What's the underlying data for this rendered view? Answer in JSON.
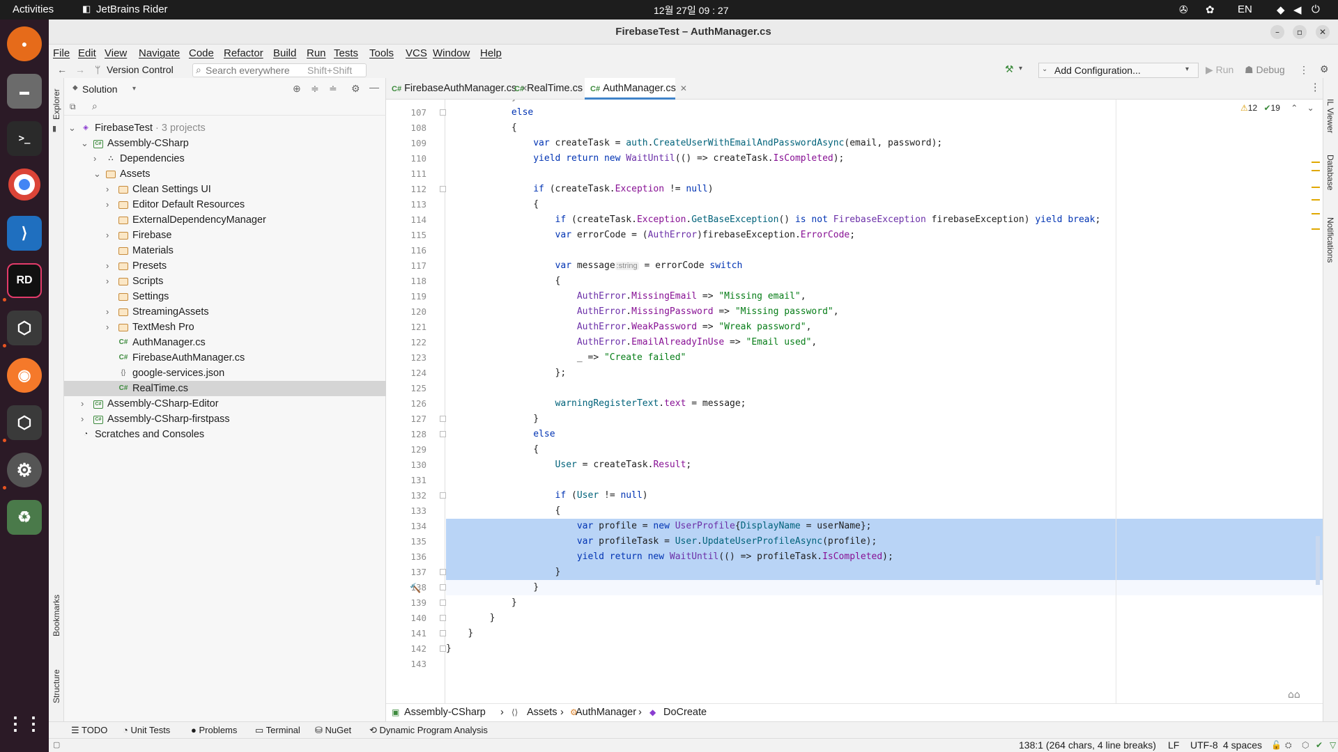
{
  "system": {
    "activities": "Activities",
    "app_name": "JetBrains Rider",
    "clock": "12월 27일  09 : 27",
    "lang": "EN"
  },
  "window": {
    "title": "FirebaseTest – AuthManager.cs"
  },
  "menu": [
    "File",
    "Edit",
    "View",
    "Navigate",
    "Code",
    "Refactor",
    "Build",
    "Run",
    "Tests",
    "Tools",
    "VCS",
    "Window",
    "Help"
  ],
  "toolbar": {
    "version_control": "Version Control",
    "search_label": "Search everywhere",
    "search_shortcut": "Shift+Shift",
    "config": "Add Configuration...",
    "run": "Run",
    "debug": "Debug"
  },
  "side": {
    "explorer": "Explorer",
    "bookmarks": "Bookmarks",
    "structure": "Structure",
    "il_viewer": "IL Viewer",
    "database": "Database",
    "notifications": "Notifications"
  },
  "explorer": {
    "header": "Solution",
    "tree": [
      {
        "label": "FirebaseTest",
        "suffix": " · 3 projects",
        "icon": "sln",
        "depth": 0,
        "arrow": "v"
      },
      {
        "label": "Assembly-CSharp",
        "icon": "proj",
        "depth": 1,
        "arrow": "v"
      },
      {
        "label": "Dependencies",
        "icon": "deps",
        "depth": 2,
        "arrow": ">"
      },
      {
        "label": "Assets",
        "icon": "folder",
        "depth": 2,
        "arrow": "v"
      },
      {
        "label": "Clean Settings UI",
        "icon": "folder",
        "depth": 3,
        "arrow": ">"
      },
      {
        "label": "Editor Default Resources",
        "icon": "folder",
        "depth": 3,
        "arrow": ">"
      },
      {
        "label": "ExternalDependencyManager",
        "icon": "folder",
        "depth": 3,
        "arrow": ""
      },
      {
        "label": "Firebase",
        "icon": "folder",
        "depth": 3,
        "arrow": ">"
      },
      {
        "label": "Materials",
        "icon": "folder",
        "depth": 3,
        "arrow": ""
      },
      {
        "label": "Presets",
        "icon": "folder",
        "depth": 3,
        "arrow": ">"
      },
      {
        "label": "Scripts",
        "icon": "folder",
        "depth": 3,
        "arrow": ">"
      },
      {
        "label": "Settings",
        "icon": "folder",
        "depth": 3,
        "arrow": ""
      },
      {
        "label": "StreamingAssets",
        "icon": "folder",
        "depth": 3,
        "arrow": ">"
      },
      {
        "label": "TextMesh Pro",
        "icon": "folder",
        "depth": 3,
        "arrow": ">"
      },
      {
        "label": "AuthManager.cs",
        "icon": "cs",
        "depth": 3,
        "arrow": ""
      },
      {
        "label": "FirebaseAuthManager.cs",
        "icon": "cs",
        "depth": 3,
        "arrow": ""
      },
      {
        "label": "google-services.json",
        "icon": "json",
        "depth": 3,
        "arrow": ""
      },
      {
        "label": "RealTime.cs",
        "icon": "cs",
        "depth": 3,
        "arrow": "",
        "selected": true
      },
      {
        "label": "Assembly-CSharp-Editor",
        "icon": "proj",
        "depth": 1,
        "arrow": ">"
      },
      {
        "label": "Assembly-CSharp-firstpass",
        "icon": "proj",
        "depth": 1,
        "arrow": ">"
      },
      {
        "label": "Scratches and Consoles",
        "icon": "scratch",
        "depth": 0,
        "arrow": ""
      }
    ]
  },
  "tabs": [
    {
      "label": "FirebaseAuthManager.cs",
      "active": false
    },
    {
      "label": "RealTime.cs",
      "active": false
    },
    {
      "label": "AuthManager.cs",
      "active": true
    }
  ],
  "inspections": {
    "warnings": "12",
    "ok": "19"
  },
  "editor": {
    "first_line": 107,
    "lines": [
      {
        "n": "107",
        "ind": 6,
        "t": [
          [
            "kw",
            "else"
          ]
        ]
      },
      {
        "n": "108",
        "ind": 6,
        "t": [
          [
            "",
            "{"
          ]
        ]
      },
      {
        "n": "109",
        "ind": 8,
        "t": [
          [
            "kw",
            "var"
          ],
          [
            "",
            " createTask = "
          ],
          [
            "me",
            "auth"
          ],
          [
            "",
            "."
          ],
          [
            "me",
            "CreateUserWithEmailAndPasswordAsync"
          ],
          [
            "",
            "(email, password);"
          ]
        ]
      },
      {
        "n": "110",
        "ind": 8,
        "t": [
          [
            "kw",
            "yield return new "
          ],
          [
            "ty",
            "WaitUntil"
          ],
          [
            "",
            "(() => createTask."
          ],
          [
            "pr",
            "IsCompleted"
          ],
          [
            "",
            ");"
          ]
        ]
      },
      {
        "n": "111",
        "ind": 0,
        "t": []
      },
      {
        "n": "112",
        "ind": 8,
        "t": [
          [
            "kw",
            "if"
          ],
          [
            "",
            " (createTask."
          ],
          [
            "pr",
            "Exception"
          ],
          [
            "",
            " != "
          ],
          [
            "kw",
            "null"
          ],
          [
            "",
            ")"
          ]
        ]
      },
      {
        "n": "113",
        "ind": 8,
        "t": [
          [
            "",
            "{"
          ]
        ]
      },
      {
        "n": "114",
        "ind": 10,
        "t": [
          [
            "kw",
            "if"
          ],
          [
            "",
            " (createTask."
          ],
          [
            "pr",
            "Exception"
          ],
          [
            "",
            "."
          ],
          [
            "me",
            "GetBaseException"
          ],
          [
            "",
            "() "
          ],
          [
            "kw",
            "is not "
          ],
          [
            "ty",
            "FirebaseException"
          ],
          [
            "",
            " firebaseException) "
          ],
          [
            "kw",
            "yield break"
          ],
          [
            "",
            ";"
          ]
        ]
      },
      {
        "n": "115",
        "ind": 10,
        "t": [
          [
            "kw",
            "var"
          ],
          [
            "",
            " errorCode = ("
          ],
          [
            "ty",
            "AuthError"
          ],
          [
            "",
            ")firebaseException."
          ],
          [
            "pr",
            "ErrorCode"
          ],
          [
            "",
            ";"
          ]
        ]
      },
      {
        "n": "116",
        "ind": 0,
        "t": []
      },
      {
        "n": "117",
        "ind": 10,
        "t": [
          [
            "kw",
            "var"
          ],
          [
            "",
            " message"
          ],
          [
            "hint",
            ":string"
          ],
          [
            "",
            " = errorCode "
          ],
          [
            "kw",
            "switch"
          ]
        ]
      },
      {
        "n": "118",
        "ind": 10,
        "t": [
          [
            "",
            "{"
          ]
        ]
      },
      {
        "n": "119",
        "ind": 12,
        "t": [
          [
            "ty",
            "AuthError"
          ],
          [
            "",
            "."
          ],
          [
            "pr",
            "MissingEmail"
          ],
          [
            "",
            " => "
          ],
          [
            "st",
            "\"Missing email\""
          ],
          [
            "",
            ","
          ]
        ]
      },
      {
        "n": "120",
        "ind": 12,
        "t": [
          [
            "ty",
            "AuthError"
          ],
          [
            "",
            "."
          ],
          [
            "pr",
            "MissingPassword"
          ],
          [
            "",
            " => "
          ],
          [
            "st",
            "\"Missing password\""
          ],
          [
            "",
            ","
          ]
        ]
      },
      {
        "n": "121",
        "ind": 12,
        "t": [
          [
            "ty",
            "AuthError"
          ],
          [
            "",
            "."
          ],
          [
            "pr",
            "WeakPassword"
          ],
          [
            "",
            " => "
          ],
          [
            "st",
            "\"Wreak password\""
          ],
          [
            "",
            ","
          ]
        ]
      },
      {
        "n": "122",
        "ind": 12,
        "t": [
          [
            "ty",
            "AuthError"
          ],
          [
            "",
            "."
          ],
          [
            "pr",
            "EmailAlreadyInUse"
          ],
          [
            "",
            " => "
          ],
          [
            "st",
            "\"Email used\""
          ],
          [
            "",
            ","
          ]
        ]
      },
      {
        "n": "123",
        "ind": 12,
        "t": [
          [
            "",
            "_ => "
          ],
          [
            "st",
            "\"Create failed\""
          ]
        ]
      },
      {
        "n": "124",
        "ind": 10,
        "t": [
          [
            "",
            "};"
          ]
        ]
      },
      {
        "n": "125",
        "ind": 0,
        "t": []
      },
      {
        "n": "126",
        "ind": 10,
        "t": [
          [
            "me",
            "warningRegisterText"
          ],
          [
            "",
            "."
          ],
          [
            "pr",
            "text"
          ],
          [
            "",
            " = message;"
          ]
        ]
      },
      {
        "n": "127",
        "ind": 8,
        "t": [
          [
            "",
            "}"
          ]
        ]
      },
      {
        "n": "128",
        "ind": 8,
        "t": [
          [
            "kw",
            "else"
          ]
        ]
      },
      {
        "n": "129",
        "ind": 8,
        "t": [
          [
            "",
            "{"
          ]
        ]
      },
      {
        "n": "130",
        "ind": 10,
        "t": [
          [
            "me",
            "User"
          ],
          [
            "",
            " = createTask."
          ],
          [
            "pr",
            "Result"
          ],
          [
            "",
            ";"
          ]
        ]
      },
      {
        "n": "131",
        "ind": 0,
        "t": []
      },
      {
        "n": "132",
        "ind": 10,
        "t": [
          [
            "kw",
            "if"
          ],
          [
            "",
            " ("
          ],
          [
            "me",
            "User"
          ],
          [
            "",
            " != "
          ],
          [
            "kw",
            "null"
          ],
          [
            "",
            ")"
          ]
        ]
      },
      {
        "n": "133",
        "ind": 10,
        "t": [
          [
            "",
            "{"
          ]
        ]
      },
      {
        "n": "134",
        "ind": 12,
        "sel": true,
        "t": [
          [
            "kw",
            "var"
          ],
          [
            "",
            " profile = "
          ],
          [
            "kw",
            "new "
          ],
          [
            "ty",
            "UserProfile"
          ],
          [
            "",
            "{"
          ],
          [
            "me",
            "DisplayName"
          ],
          [
            "",
            " = userName};"
          ]
        ]
      },
      {
        "n": "135",
        "ind": 12,
        "sel": true,
        "t": [
          [
            "kw",
            "var"
          ],
          [
            "",
            " profileTask = "
          ],
          [
            "me",
            "User"
          ],
          [
            "",
            "."
          ],
          [
            "me",
            "UpdateUserProfileAsync"
          ],
          [
            "",
            "(profile);"
          ]
        ]
      },
      {
        "n": "136",
        "ind": 12,
        "sel": true,
        "t": [
          [
            "kw",
            "yield return new "
          ],
          [
            "ty",
            "WaitUntil"
          ],
          [
            "",
            "(() => profileTask."
          ],
          [
            "pr",
            "IsCompleted"
          ],
          [
            "",
            ");"
          ]
        ]
      },
      {
        "n": "137",
        "ind": 10,
        "sel": true,
        "t": [
          [
            "",
            "}"
          ]
        ]
      },
      {
        "n": "138",
        "ind": 8,
        "cur": true,
        "t": [
          [
            "",
            "}"
          ]
        ]
      },
      {
        "n": "139",
        "ind": 6,
        "t": [
          [
            "",
            "}"
          ]
        ]
      },
      {
        "n": "140",
        "ind": 4,
        "t": [
          [
            "",
            "}"
          ]
        ]
      },
      {
        "n": "141",
        "ind": 2,
        "t": [
          [
            "",
            "}"
          ]
        ]
      },
      {
        "n": "142",
        "ind": 0,
        "t": [
          [
            "",
            "}"
          ]
        ]
      },
      {
        "n": "143",
        "ind": 0,
        "t": []
      }
    ]
  },
  "breadcrumbs": [
    "Assembly-CSharp",
    "Assets",
    "AuthManager",
    "DoCreate"
  ],
  "bottom_tools": [
    "TODO",
    "Unit Tests",
    "Problems",
    "Terminal",
    "NuGet",
    "Dynamic Program Analysis"
  ],
  "status": {
    "position": "138:1 (264 chars, 4 line breaks)",
    "line_sep": "LF",
    "encoding": "UTF-8",
    "indent": "4 spaces"
  }
}
